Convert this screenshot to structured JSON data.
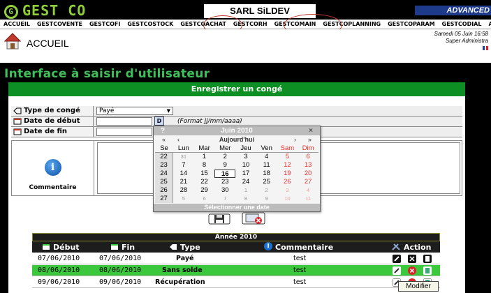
{
  "app": {
    "logo_text": "GEST CO",
    "company": "SARL SiLDEV",
    "edition": "ADVANCED"
  },
  "menu": [
    "ACCUEIL",
    "GESTCOVENTE",
    "GESTCOFI",
    "GESTCOSTOCK",
    "GESTCOACHAT",
    "GESTCORH",
    "GESTCOMAIN",
    "GESTCOPLANNING",
    "GESTCOPARAM",
    "GESTCODIAL",
    "AIDE"
  ],
  "page": {
    "title": "ACCUEIL",
    "date_line": "Samedi 05 Juin 16:58",
    "user_line": "Super Administra"
  },
  "heading": "Interface  à saisir  d'utilisateur",
  "form": {
    "title": "Enregistrer un congé",
    "type_label": "Type de congé",
    "type_value": "Payé",
    "start_label": "Date de début",
    "start_value": "",
    "format_hint": "(Format jj/mm/aaaa)",
    "end_label": "Date de fin",
    "end_value": "",
    "comment_label": "Commentaire",
    "calendar_button": "D"
  },
  "calendar": {
    "help": "?",
    "month": "Juin 2010",
    "close": "×",
    "prev_year": "«",
    "prev_month": "‹",
    "today": "Aujourd'hui",
    "next_month": "›",
    "next_year": "»",
    "headers": [
      "Se",
      "Lun",
      "Mar",
      "Mer",
      "Jeu",
      "Ven",
      "Sam",
      "Dim"
    ],
    "weeks": [
      {
        "wk": "22",
        "days": [
          "31",
          "1",
          "2",
          "3",
          "4",
          "5",
          "6"
        ]
      },
      {
        "wk": "23",
        "days": [
          "7",
          "8",
          "9",
          "10",
          "11",
          "12",
          "13"
        ]
      },
      {
        "wk": "24",
        "days": [
          "14",
          "15",
          "16",
          "17",
          "18",
          "19",
          "20"
        ]
      },
      {
        "wk": "25",
        "days": [
          "21",
          "22",
          "23",
          "24",
          "25",
          "26",
          "27"
        ]
      },
      {
        "wk": "26",
        "days": [
          "28",
          "29",
          "30",
          "1",
          "2",
          "3",
          "4"
        ]
      },
      {
        "wk": "27",
        "days": [
          "5",
          "6",
          "7",
          "8",
          "9",
          "10",
          "11"
        ]
      }
    ],
    "selected": "16",
    "footer": "Sélectionner une date"
  },
  "table": {
    "year": "Année 2010",
    "headers": [
      "Début",
      "Fin",
      "Type",
      "Commentaire",
      "Action"
    ],
    "rows": [
      {
        "debut": "07/06/2010",
        "fin": "07/06/2010",
        "type": "Payé",
        "commentaire": "test"
      },
      {
        "debut": "08/06/2010",
        "fin": "08/06/2010",
        "type": "Sans solde",
        "commentaire": "test"
      },
      {
        "debut": "09/06/2010",
        "fin": "09/06/2010",
        "type": "Récupération",
        "commentaire": "test"
      }
    ],
    "tooltip": "Modifier"
  },
  "colors": {
    "accent_green": "#0e8f23",
    "heading_green": "#3fbf5a",
    "highlight_row": "#3cc83c",
    "weekend_red": "#e8352f",
    "annotation_circle": "#c0392b"
  }
}
